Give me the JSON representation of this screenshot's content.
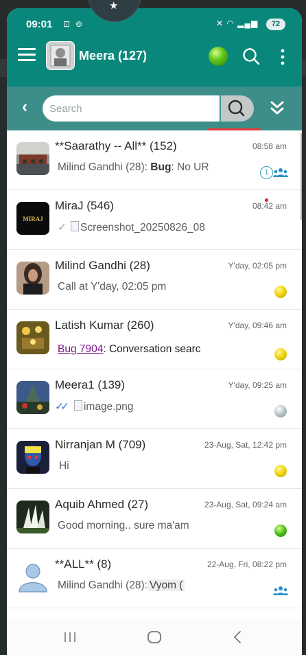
{
  "status_bar": {
    "time": "09:01",
    "battery": "72"
  },
  "app_bar": {
    "title": "Meera (127)"
  },
  "search": {
    "placeholder": "Search"
  },
  "conversations": [
    {
      "name": "**Saarathy -- All** (152)",
      "time": "08:58 am",
      "sender": "Milind Gandhi (28)",
      "label": "Bug",
      "text": "No UR",
      "unread": "1",
      "group": true
    },
    {
      "name": "MiraJ (546)",
      "avatar_text": "MIRAJ",
      "time": "08:42 am",
      "text": "Screenshot_20250826_08"
    },
    {
      "name": "Milind Gandhi (28)",
      "time": "Y'day, 02:05 pm",
      "text": "Call at Y'day, 02:05 pm",
      "status": "yellow"
    },
    {
      "name": "Latish Kumar (260)",
      "time": "Y'day, 09:46 am",
      "link": "Bug 7904",
      "text": ": Conversation searc",
      "status": "yellow"
    },
    {
      "name": "Meera1 (139)",
      "time": "Y'day, 09:25 am",
      "text": "image.png",
      "status": "grey"
    },
    {
      "name": "Nirranjan M (709)",
      "time": "23-Aug, Sat, 12:42 pm",
      "text": "Hi",
      "status": "yellow"
    },
    {
      "name": "Aquib Ahmed (27)",
      "time": "23-Aug, Sat, 09:24 am",
      "text": "Good morning.. sure ma'am",
      "status": "green"
    },
    {
      "name": "**ALL** (8)",
      "time": "22-Aug, Fri, 08:22 pm",
      "sender": "Milind Gandhi (28):",
      "text": "Vyom (",
      "group": true
    }
  ],
  "colors": {
    "header": "#09877a",
    "searchbar": "#3d8d88",
    "link": "#7a1a85",
    "accent_red": "#e23a3a"
  }
}
